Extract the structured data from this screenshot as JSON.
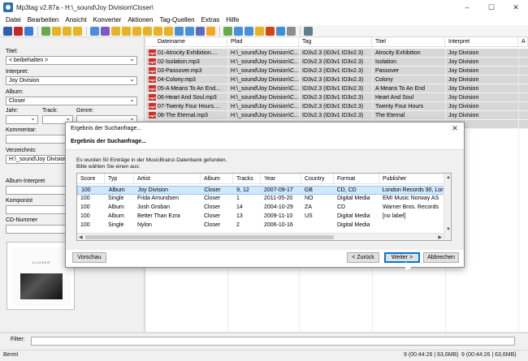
{
  "window": {
    "title": "Mp3tag v2.87a  -  H:\\_sound\\Joy Division\\Closer\\",
    "controls": [
      "–",
      "☐",
      "✕"
    ]
  },
  "menu": [
    "Datei",
    "Bearbeiten",
    "Ansicht",
    "Konverter",
    "Aktionen",
    "Tag-Quellen",
    "Extras",
    "Hilfe"
  ],
  "tag_panel": {
    "titel_label": "Titel:",
    "titel_value": "< beibehalten >",
    "interpret_label": "Interpret:",
    "interpret_value": "Joy Division",
    "album_label": "Album:",
    "album_value": "Closer",
    "jahr_label": "Jahr:",
    "track_label": "Track:",
    "genre_label": "Genre:",
    "kommentar_label": "Kommentar:",
    "verzeichnis_label": "Verzeichnis:",
    "verzeichnis_value": "H:\\_sound\\Joy Division\\",
    "album_interpret_label": "Album-Interpret",
    "komponist_label": "Komponist",
    "cd_nummer_label": "CD-Nummer",
    "cover_text": "CLOSER"
  },
  "file_list": {
    "columns": [
      "Dateiname",
      "Pfad",
      "Tag",
      "Titel",
      "Interpret",
      "A"
    ],
    "icon_text": "mp3",
    "rows": [
      {
        "file": "01-Atrocity Exhibition....",
        "path": "H:\\_sound\\Joy Division\\C...",
        "tag": "ID3v2.3 (ID3v1 ID3v2.3)",
        "title": "Atrocity Exhibition",
        "artist": "Joy Division"
      },
      {
        "file": "02-Isolation.mp3",
        "path": "H:\\_sound\\Joy Division\\C...",
        "tag": "ID3v2.3 (ID3v1 ID3v2.3)",
        "title": "Isolation",
        "artist": "Joy Division"
      },
      {
        "file": "03-Passover.mp3",
        "path": "H:\\_sound\\Joy Division\\C...",
        "tag": "ID3v2.3 (ID3v1 ID3v2.3)",
        "title": "Passover",
        "artist": "Joy Division"
      },
      {
        "file": "04-Colony.mp3",
        "path": "H:\\_sound\\Joy Division\\C...",
        "tag": "ID3v2.3 (ID3v1 ID3v2.3)",
        "title": "Colony",
        "artist": "Joy Division"
      },
      {
        "file": "05-A Means To An End...",
        "path": "H:\\_sound\\Joy Division\\C...",
        "tag": "ID3v2.3 (ID3v1 ID3v2.3)",
        "title": "A Means To An End",
        "artist": "Joy Division"
      },
      {
        "file": "06-Heart And Soul.mp3",
        "path": "H:\\_sound\\Joy Division\\C...",
        "tag": "ID3v2.3 (ID3v1 ID3v2.3)",
        "title": "Heart And Soul",
        "artist": "Joy Division"
      },
      {
        "file": "07-Twenty Four Hours....",
        "path": "H:\\_sound\\Joy Division\\C...",
        "tag": "ID3v2.3 (ID3v1 ID3v2.3)",
        "title": "Twenty Four Hours",
        "artist": "Joy Division"
      },
      {
        "file": "08-The Eternal.mp3",
        "path": "H:\\_sound\\Joy Division\\C...",
        "tag": "ID3v2.3 (ID3v1 ID3v2.3)",
        "title": "The Eternal",
        "artist": "Joy Division"
      }
    ]
  },
  "filter": {
    "label": "Filter:"
  },
  "status": {
    "ready": "Bereit",
    "selection": "9 (00:44:26 | 63,6MB)",
    "total": "9 (00:44:26 | 63,6MB)"
  },
  "dialog": {
    "title": "Ergebnis der Suchanfrage...",
    "heading": "Ergebnis der Suchanfrage...",
    "info_line1": "Es wurden 50 Einträge in der MusicBrainz-Datenbank gefunden.",
    "info_line2": "Bitte wählen Sie einen aus:",
    "columns": [
      "Score",
      "Typ",
      "Artist",
      "Album",
      "Tracks",
      "Year",
      "Country",
      "Format",
      "Publisher"
    ],
    "rows": [
      {
        "score": "100",
        "type": "Album",
        "artist": "Joy Division",
        "album": "Closer",
        "tracks": "9, 12",
        "year": "2007-09-17",
        "country": "GB",
        "format": "CD, CD",
        "publisher": "London Records 90, Lon"
      },
      {
        "score": "100",
        "type": "Single",
        "artist": "Frida Amundsen",
        "album": "Closer",
        "tracks": "1",
        "year": "2011-05-20",
        "country": "NO",
        "format": "Digital Media",
        "publisher": "EMI Music Norway AS"
      },
      {
        "score": "100",
        "type": "Album",
        "artist": "Josh Groban",
        "album": "Closer",
        "tracks": "14",
        "year": "2004-10-29",
        "country": "ZA",
        "format": "CD",
        "publisher": "Warner Bros. Records"
      },
      {
        "score": "100",
        "type": "Album",
        "artist": "Better Than Ezra",
        "album": "Closer",
        "tracks": "13",
        "year": "2009-11-10",
        "country": "US",
        "format": "Digital Media",
        "publisher": "[no label]"
      },
      {
        "score": "100",
        "type": "Single",
        "artist": "Nylon",
        "album": "Closer",
        "tracks": "2",
        "year": "2006-10-16",
        "country": "",
        "format": "Digital Media",
        "publisher": ""
      }
    ],
    "buttons": {
      "preview": "Vorschau",
      "back": "< Zurück",
      "next": "Weiter >",
      "cancel": "Abbrechen"
    }
  }
}
